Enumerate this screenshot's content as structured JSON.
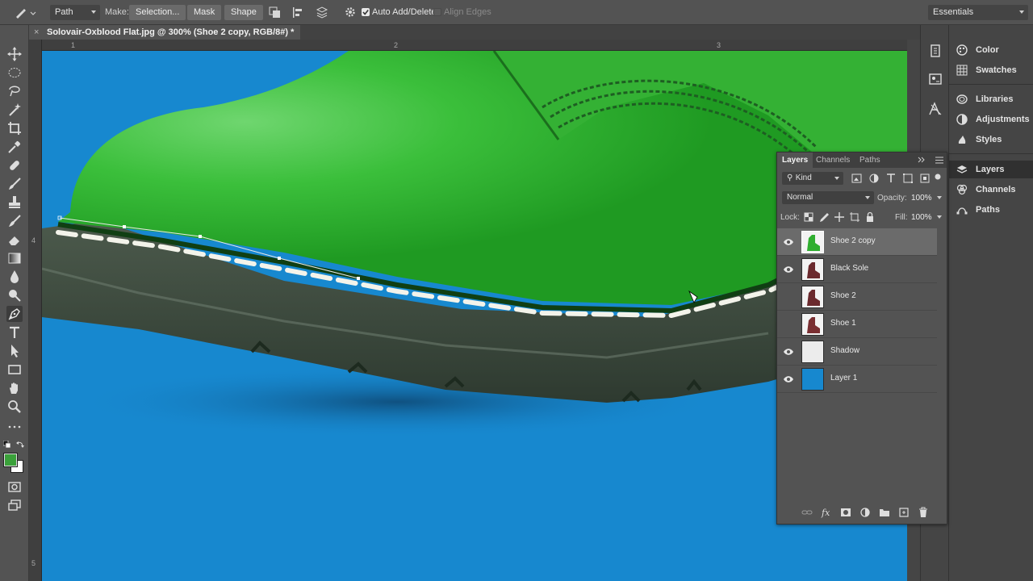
{
  "optionsbar": {
    "mode": "Path",
    "make_label": "Make:",
    "selection_btn": "Selection...",
    "mask_btn": "Mask",
    "shape_btn": "Shape",
    "auto_add_delete": "Auto Add/Delete",
    "align_edges": "Align Edges",
    "workspace": "Essentials"
  },
  "document": {
    "tab_title": "Solovair-Oxblood Flat.jpg @ 300% (Shoe 2 copy, RGB/8#) *"
  },
  "rulers": {
    "top": [
      "1",
      "2",
      "3"
    ],
    "left": [
      "4",
      "5"
    ]
  },
  "right_panel": {
    "group1": [
      "Color",
      "Swatches"
    ],
    "group2": [
      "Libraries",
      "Adjustments",
      "Styles"
    ],
    "group3": [
      "Layers",
      "Channels",
      "Paths"
    ]
  },
  "layers_panel": {
    "tabs": [
      "Layers",
      "Channels",
      "Paths"
    ],
    "filter_kind": "Kind",
    "blend_mode": "Normal",
    "opacity_label": "Opacity:",
    "opacity_value": "100%",
    "lock_label": "Lock:",
    "fill_label": "Fill:",
    "fill_value": "100%",
    "layers": [
      {
        "name": "Shoe 2 copy",
        "visible": true,
        "selected": true,
        "thumb": "green-shoe"
      },
      {
        "name": "Black Sole",
        "visible": true,
        "selected": false,
        "thumb": "red-shoe"
      },
      {
        "name": "Shoe 2",
        "visible": false,
        "selected": false,
        "thumb": "red-shoe"
      },
      {
        "name": "Shoe 1",
        "visible": false,
        "selected": false,
        "thumb": "red-shoe"
      },
      {
        "name": "Shadow",
        "visible": true,
        "selected": false,
        "thumb": "transparent"
      },
      {
        "name": "Layer 1",
        "visible": true,
        "selected": false,
        "thumb": "blue-fill"
      }
    ]
  },
  "colors": {
    "foreground": "#3aa13a",
    "background": "#ffffff",
    "canvas_bg": "#1788cf",
    "shoe_green": "#2fb52f"
  }
}
